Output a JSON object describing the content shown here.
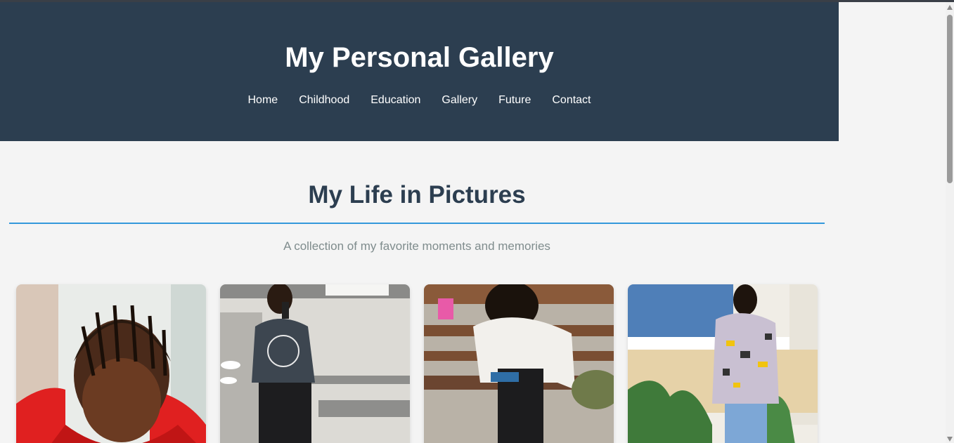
{
  "header": {
    "title": "My Personal Gallery",
    "nav": [
      {
        "label": "Home"
      },
      {
        "label": "Childhood"
      },
      {
        "label": "Education"
      },
      {
        "label": "Gallery"
      },
      {
        "label": "Future"
      },
      {
        "label": "Contact"
      }
    ]
  },
  "main": {
    "section_title": "My Life in Pictures",
    "subtitle": "A collection of my favorite moments and memories"
  },
  "photos": [
    {
      "name": "photo-braided-hair-red-jacket"
    },
    {
      "name": "photo-mirror-selfie"
    },
    {
      "name": "photo-seated-phone"
    },
    {
      "name": "photo-camo-jacket-standing"
    }
  ],
  "colors": {
    "header_bg": "#2c3e50",
    "accent": "#3498db",
    "heading": "#2c3e50",
    "subtitle": "#7f8c8d",
    "page_bg": "#f4f4f4"
  }
}
